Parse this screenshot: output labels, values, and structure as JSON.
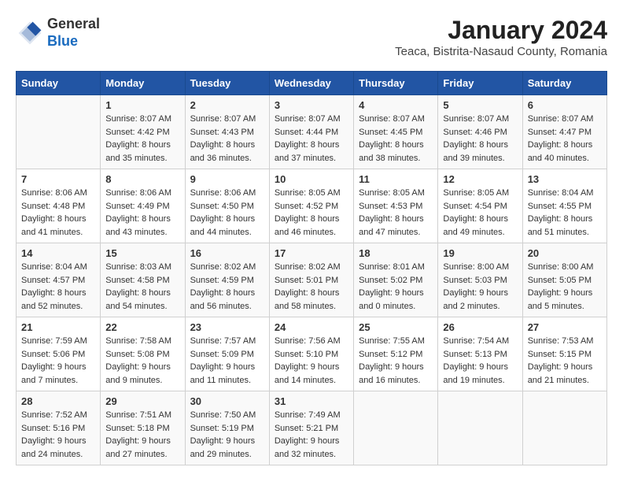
{
  "logo": {
    "general": "General",
    "blue": "Blue"
  },
  "header": {
    "month": "January 2024",
    "location": "Teaca, Bistrita-Nasaud County, Romania"
  },
  "weekdays": [
    "Sunday",
    "Monday",
    "Tuesday",
    "Wednesday",
    "Thursday",
    "Friday",
    "Saturday"
  ],
  "weeks": [
    [
      {
        "day": "",
        "info": ""
      },
      {
        "day": "1",
        "info": "Sunrise: 8:07 AM\nSunset: 4:42 PM\nDaylight: 8 hours\nand 35 minutes."
      },
      {
        "day": "2",
        "info": "Sunrise: 8:07 AM\nSunset: 4:43 PM\nDaylight: 8 hours\nand 36 minutes."
      },
      {
        "day": "3",
        "info": "Sunrise: 8:07 AM\nSunset: 4:44 PM\nDaylight: 8 hours\nand 37 minutes."
      },
      {
        "day": "4",
        "info": "Sunrise: 8:07 AM\nSunset: 4:45 PM\nDaylight: 8 hours\nand 38 minutes."
      },
      {
        "day": "5",
        "info": "Sunrise: 8:07 AM\nSunset: 4:46 PM\nDaylight: 8 hours\nand 39 minutes."
      },
      {
        "day": "6",
        "info": "Sunrise: 8:07 AM\nSunset: 4:47 PM\nDaylight: 8 hours\nand 40 minutes."
      }
    ],
    [
      {
        "day": "7",
        "info": "Sunrise: 8:06 AM\nSunset: 4:48 PM\nDaylight: 8 hours\nand 41 minutes."
      },
      {
        "day": "8",
        "info": "Sunrise: 8:06 AM\nSunset: 4:49 PM\nDaylight: 8 hours\nand 43 minutes."
      },
      {
        "day": "9",
        "info": "Sunrise: 8:06 AM\nSunset: 4:50 PM\nDaylight: 8 hours\nand 44 minutes."
      },
      {
        "day": "10",
        "info": "Sunrise: 8:05 AM\nSunset: 4:52 PM\nDaylight: 8 hours\nand 46 minutes."
      },
      {
        "day": "11",
        "info": "Sunrise: 8:05 AM\nSunset: 4:53 PM\nDaylight: 8 hours\nand 47 minutes."
      },
      {
        "day": "12",
        "info": "Sunrise: 8:05 AM\nSunset: 4:54 PM\nDaylight: 8 hours\nand 49 minutes."
      },
      {
        "day": "13",
        "info": "Sunrise: 8:04 AM\nSunset: 4:55 PM\nDaylight: 8 hours\nand 51 minutes."
      }
    ],
    [
      {
        "day": "14",
        "info": "Sunrise: 8:04 AM\nSunset: 4:57 PM\nDaylight: 8 hours\nand 52 minutes."
      },
      {
        "day": "15",
        "info": "Sunrise: 8:03 AM\nSunset: 4:58 PM\nDaylight: 8 hours\nand 54 minutes."
      },
      {
        "day": "16",
        "info": "Sunrise: 8:02 AM\nSunset: 4:59 PM\nDaylight: 8 hours\nand 56 minutes."
      },
      {
        "day": "17",
        "info": "Sunrise: 8:02 AM\nSunset: 5:01 PM\nDaylight: 8 hours\nand 58 minutes."
      },
      {
        "day": "18",
        "info": "Sunrise: 8:01 AM\nSunset: 5:02 PM\nDaylight: 9 hours\nand 0 minutes."
      },
      {
        "day": "19",
        "info": "Sunrise: 8:00 AM\nSunset: 5:03 PM\nDaylight: 9 hours\nand 2 minutes."
      },
      {
        "day": "20",
        "info": "Sunrise: 8:00 AM\nSunset: 5:05 PM\nDaylight: 9 hours\nand 5 minutes."
      }
    ],
    [
      {
        "day": "21",
        "info": "Sunrise: 7:59 AM\nSunset: 5:06 PM\nDaylight: 9 hours\nand 7 minutes."
      },
      {
        "day": "22",
        "info": "Sunrise: 7:58 AM\nSunset: 5:08 PM\nDaylight: 9 hours\nand 9 minutes."
      },
      {
        "day": "23",
        "info": "Sunrise: 7:57 AM\nSunset: 5:09 PM\nDaylight: 9 hours\nand 11 minutes."
      },
      {
        "day": "24",
        "info": "Sunrise: 7:56 AM\nSunset: 5:10 PM\nDaylight: 9 hours\nand 14 minutes."
      },
      {
        "day": "25",
        "info": "Sunrise: 7:55 AM\nSunset: 5:12 PM\nDaylight: 9 hours\nand 16 minutes."
      },
      {
        "day": "26",
        "info": "Sunrise: 7:54 AM\nSunset: 5:13 PM\nDaylight: 9 hours\nand 19 minutes."
      },
      {
        "day": "27",
        "info": "Sunrise: 7:53 AM\nSunset: 5:15 PM\nDaylight: 9 hours\nand 21 minutes."
      }
    ],
    [
      {
        "day": "28",
        "info": "Sunrise: 7:52 AM\nSunset: 5:16 PM\nDaylight: 9 hours\nand 24 minutes."
      },
      {
        "day": "29",
        "info": "Sunrise: 7:51 AM\nSunset: 5:18 PM\nDaylight: 9 hours\nand 27 minutes."
      },
      {
        "day": "30",
        "info": "Sunrise: 7:50 AM\nSunset: 5:19 PM\nDaylight: 9 hours\nand 29 minutes."
      },
      {
        "day": "31",
        "info": "Sunrise: 7:49 AM\nSunset: 5:21 PM\nDaylight: 9 hours\nand 32 minutes."
      },
      {
        "day": "",
        "info": ""
      },
      {
        "day": "",
        "info": ""
      },
      {
        "day": "",
        "info": ""
      }
    ]
  ]
}
